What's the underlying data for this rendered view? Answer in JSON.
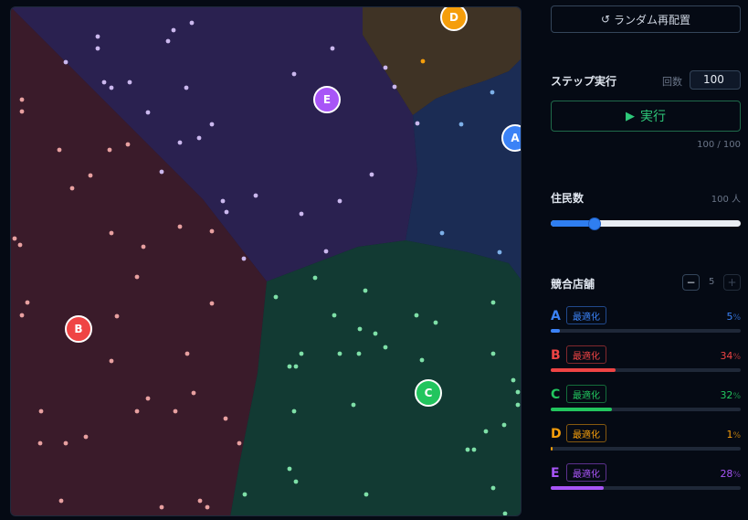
{
  "map": {
    "stores": [
      {
        "id": "A",
        "color": "#3b82f6",
        "region": "#1b2c54",
        "dot": "#7db0e8"
      },
      {
        "id": "B",
        "color": "#ef4444",
        "region": "#3a1b2a",
        "dot": "#e8a0a0"
      },
      {
        "id": "C",
        "color": "#22c55e",
        "region": "#123a33",
        "dot": "#7ee0a8"
      },
      {
        "id": "D",
        "color": "#f59e0b",
        "region": "#3f3325",
        "dot": "#f59e0b"
      },
      {
        "id": "E",
        "color": "#a855f7",
        "region": "#2a2150",
        "dot": "#cbb8ee"
      }
    ]
  },
  "controls": {
    "reshuffle_icon": "refresh-icon",
    "reshuffle_glyph": "↺",
    "reshuffle_label": "ランダム再配置",
    "step_title": "ステップ実行",
    "count_label": "回数",
    "count_value": "100",
    "run_glyph": "▶",
    "run_label": "実行",
    "progress_text": "100 / 100"
  },
  "population": {
    "title": "住民数",
    "value_text": "100 人",
    "slider_fraction": 0.2
  },
  "competitors": {
    "title": "競合店舗",
    "minus": "−",
    "plus": "+",
    "count": "5",
    "optimize_label": "最適化",
    "percent_sign": "%",
    "items": [
      {
        "letter": "A",
        "share": "5",
        "fraction": 0.05,
        "color": "#3b82f6"
      },
      {
        "letter": "B",
        "share": "34",
        "fraction": 0.34,
        "color": "#ef4444"
      },
      {
        "letter": "C",
        "share": "32",
        "fraction": 0.32,
        "color": "#22c55e"
      },
      {
        "letter": "D",
        "share": "1",
        "fraction": 0.01,
        "color": "#f59e0b"
      },
      {
        "letter": "E",
        "share": "28",
        "fraction": 0.28,
        "color": "#a855f7"
      }
    ]
  }
}
